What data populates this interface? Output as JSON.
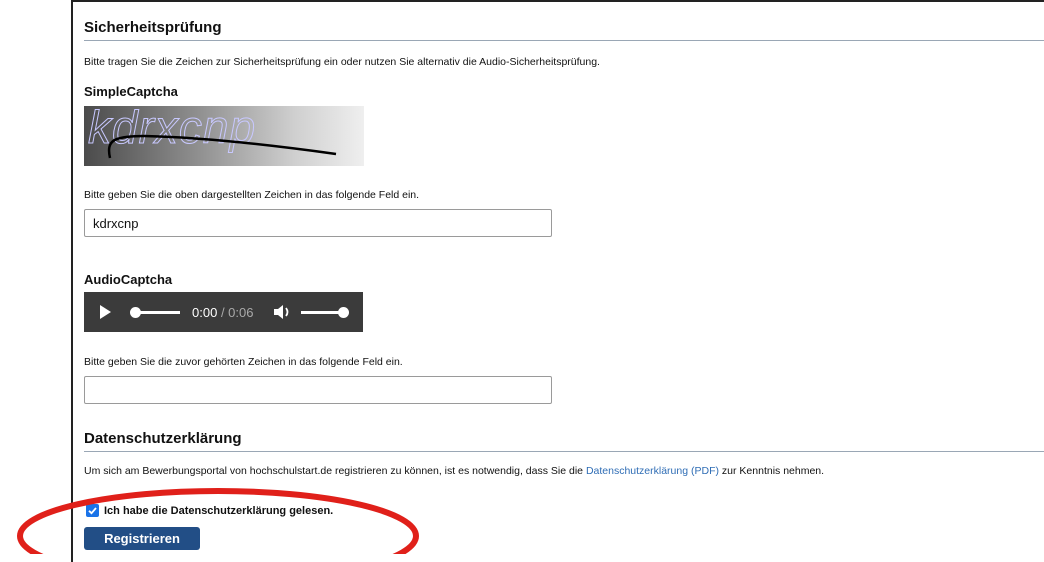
{
  "security": {
    "title": "Sicherheitsprüfung",
    "intro": "Bitte tragen Sie die Zeichen zur Sicherheitsprüfung ein oder nutzen Sie alternativ die Audio-Sicherheitsprüfung.",
    "simple_captcha": {
      "heading": "SimpleCaptcha",
      "image_text": "kdrxcnp",
      "instruction": "Bitte geben Sie die oben dargestellten Zeichen in das folgende Feld ein.",
      "input_value": "kdrxcnp"
    },
    "audio_captcha": {
      "heading": "AudioCaptcha",
      "current_time": "0:00",
      "duration": "/ 0:06",
      "instruction": "Bitte geben Sie die zuvor gehörten Zeichen in das folgende Feld ein.",
      "input_value": ""
    }
  },
  "privacy": {
    "title": "Datenschutzerklärung",
    "text_before": "Um sich am Bewerbungsportal von hochschulstart.de registrieren zu können, ist es notwendig, dass Sie die ",
    "link": "Datenschutzerklärung (PDF)",
    "text_after": " zur Kenntnis nehmen.",
    "checkbox_label": "Ich habe die Datenschutzerklärung gelesen.",
    "checkbox_checked": true
  },
  "register_button": "Registrieren",
  "colors": {
    "button": "#224e86",
    "link": "#2f6db5",
    "highlight_ellipse": "#e0201a"
  }
}
